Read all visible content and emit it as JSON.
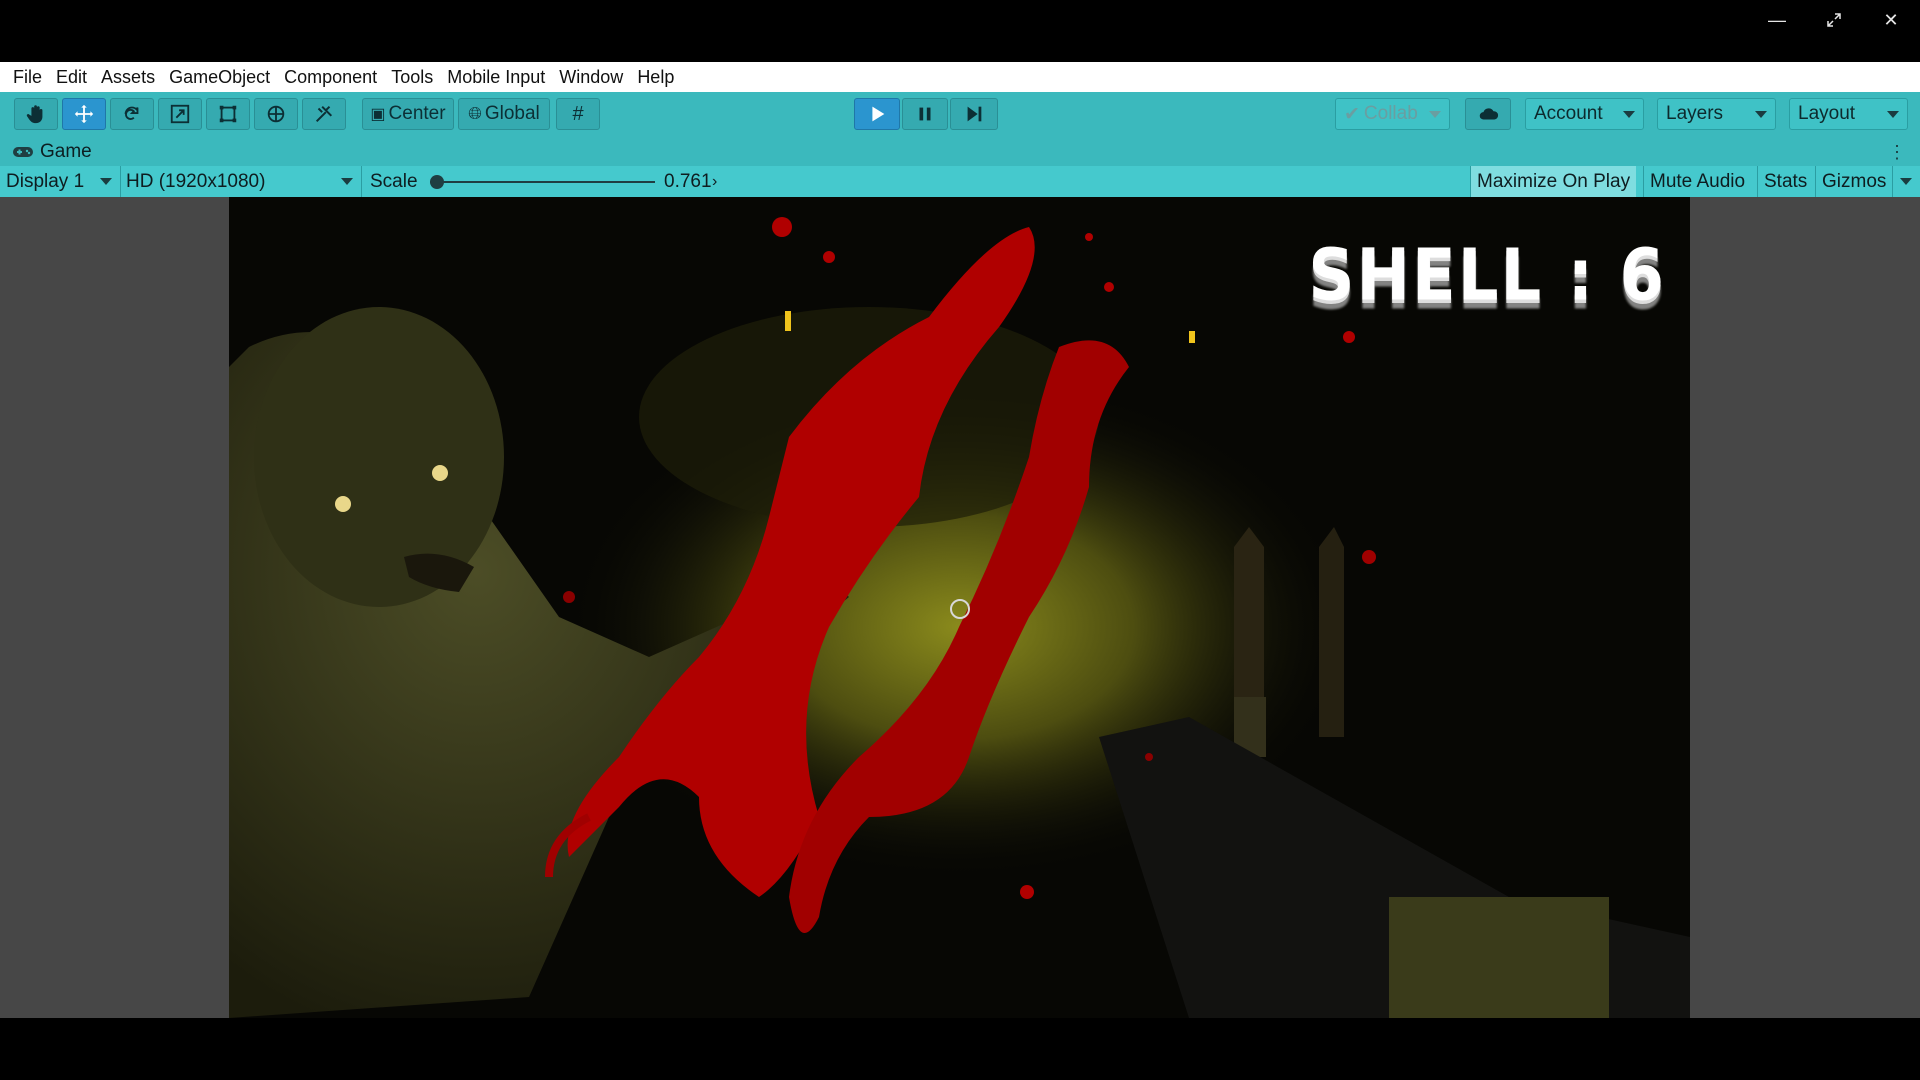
{
  "window": {
    "controls": [
      "minimize-icon",
      "restore-icon",
      "close-icon"
    ]
  },
  "menu": {
    "items": [
      "File",
      "Edit",
      "Assets",
      "GameObject",
      "Component",
      "Tools",
      "Mobile Input",
      "Window",
      "Help"
    ]
  },
  "toolbar": {
    "tools": [
      "hand-icon",
      "move-icon",
      "rotate-icon",
      "scale-icon",
      "rect-icon",
      "transform-icon",
      "custom-tool-icon"
    ],
    "pivot_label": "Center",
    "space_label": "Global",
    "playback": [
      "play-icon",
      "pause-icon",
      "step-icon"
    ],
    "collab_label": "Collab",
    "account_label": "Account",
    "layers_label": "Layers",
    "layout_label": "Layout"
  },
  "game_tab": {
    "title": "Game",
    "display": "Display 1",
    "resolution": "HD (1920x1080)",
    "scale_label": "Scale",
    "scale_value": "0.761",
    "scale_fraction": 0.0,
    "maximize_label": "Maximize On Play",
    "mute_label": "Mute Audio",
    "stats_label": "Stats",
    "gizmos_label": "Gizmos"
  },
  "hud": {
    "shell_text": "SHELL : 6"
  },
  "colors": {
    "toolbar": "#3bb9bd",
    "play_active": "#2b95cf",
    "blood": "#b00000"
  }
}
